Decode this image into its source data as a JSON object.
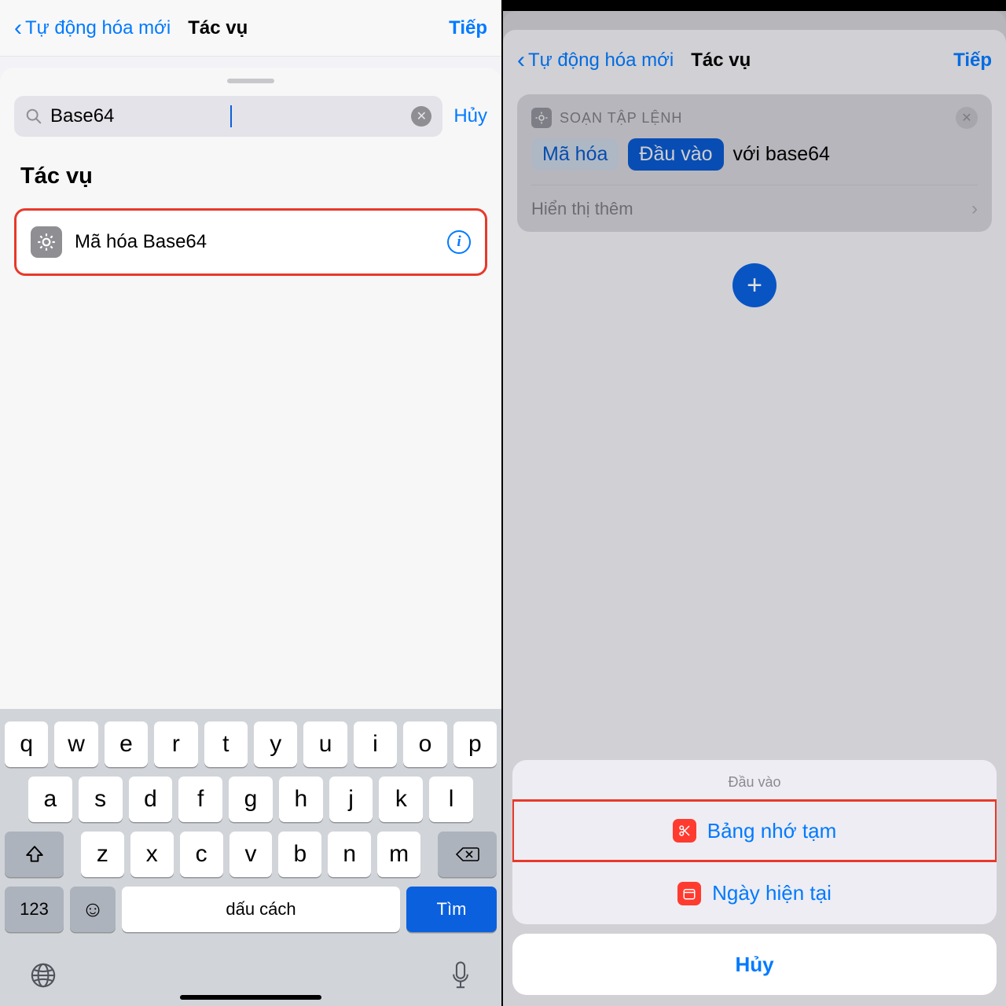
{
  "left": {
    "nav": {
      "back": "Tự động hóa mới",
      "title": "Tác vụ",
      "next": "Tiếp"
    },
    "search": {
      "value": "Base64",
      "cancel": "Hủy"
    },
    "section_title": "Tác vụ",
    "result": {
      "label": "Mã hóa Base64"
    },
    "keyboard": {
      "row1": [
        "q",
        "w",
        "e",
        "r",
        "t",
        "y",
        "u",
        "i",
        "o",
        "p"
      ],
      "row2": [
        "a",
        "s",
        "d",
        "f",
        "g",
        "h",
        "j",
        "k",
        "l"
      ],
      "row3": [
        "z",
        "x",
        "c",
        "v",
        "b",
        "n",
        "m"
      ],
      "numbers": "123",
      "space": "dấu cách",
      "search": "Tìm"
    }
  },
  "right": {
    "nav": {
      "back": "Tự động hóa mới",
      "title": "Tác vụ",
      "next": "Tiếp"
    },
    "card": {
      "group": "SOẠN TẬP LỆNH",
      "token1": "Mã hóa",
      "token2": "Đầu vào",
      "suffix": "với base64",
      "more": "Hiển thị thêm"
    },
    "add": "+",
    "menu": {
      "title": "Đầu vào",
      "item1": "Bảng nhớ tạm",
      "item2": "Ngày hiện tại",
      "cancel": "Hủy"
    }
  }
}
